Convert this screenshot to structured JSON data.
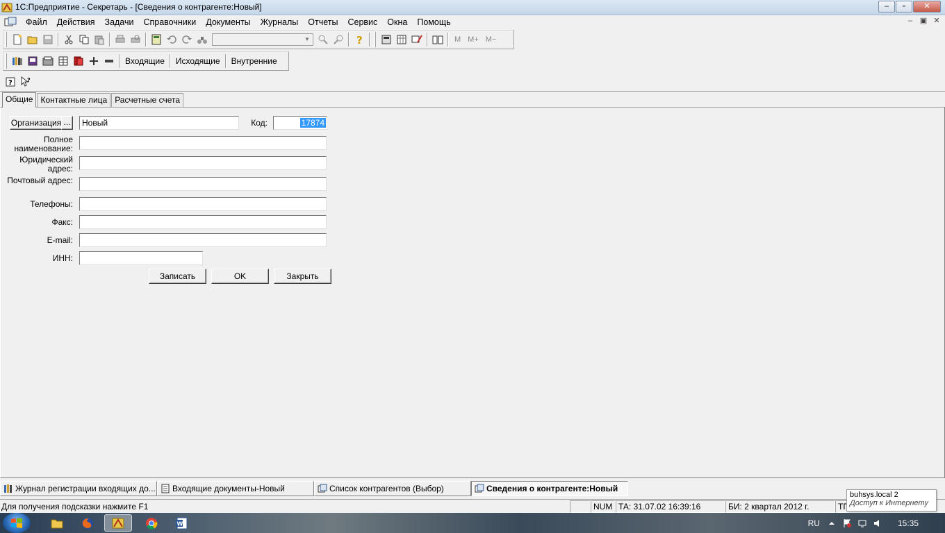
{
  "window": {
    "title": "1С:Предприятие - Секретарь - [Сведения о контрагенте:Новый]",
    "minimize": "–",
    "maximize": "▫",
    "close": "✕"
  },
  "menu": {
    "items": [
      "Файл",
      "Действия",
      "Задачи",
      "Справочники",
      "Документы",
      "Журналы",
      "Отчеты",
      "Сервис",
      "Окна",
      "Помощь"
    ],
    "mdi_minimize": "–",
    "mdi_restore": "▣",
    "mdi_close": "✕"
  },
  "toolbar1": {
    "memory": [
      "M",
      "M+",
      "M−"
    ]
  },
  "toolbar2": {
    "buttons": [
      "Входящие",
      "Исходящие",
      "Внутренние"
    ]
  },
  "tabs": [
    "Общие",
    "Контактные лица",
    "Расчетные счета"
  ],
  "form": {
    "org_button": "Организация",
    "org_select": "...",
    "name_value": "Новый",
    "code_label": "Код:",
    "code_value": "17874",
    "full_name_label": "Полное наименование:",
    "legal_address_label": "Юридический адрес:",
    "postal_address_label": "Почтовый адрес:",
    "phones_label": "Телефоны:",
    "fax_label": "Факс:",
    "email_label": "E-mail:",
    "inn_label": "ИНН:",
    "save_button": "Записать",
    "ok_button": "OK",
    "close_button": "Закрыть"
  },
  "window_list": [
    {
      "label": "Журнал регистрации входящих до...",
      "active": false
    },
    {
      "label": "Входящие документы-Новый",
      "active": false
    },
    {
      "label": "Список контрагентов (Выбор)",
      "active": false
    },
    {
      "label": "Сведения о контрагенте:Новый",
      "active": true
    }
  ],
  "statusbar": {
    "hint": "Для получения подсказки нажмите F1",
    "num": "NUM",
    "ta": "ТА: 31.07.02  16:39:16",
    "bi": "БИ: 2 квартал 2012 г.",
    "tp": "ТП"
  },
  "tooltip": {
    "line1": "buhsys.local  2",
    "line2": "Доступ к Интернету"
  },
  "taskbar": {
    "lang": "RU",
    "time": "15:35"
  },
  "colors": {
    "selection": "#3399ff",
    "window_bg": "#f0f0f0"
  }
}
